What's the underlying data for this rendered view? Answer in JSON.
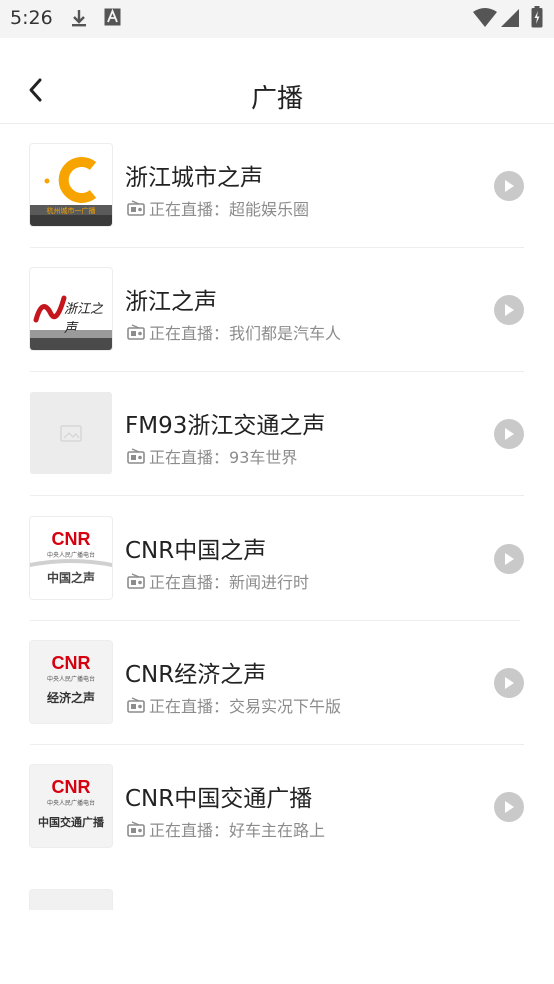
{
  "status_bar": {
    "time": "5:26",
    "left_icons": [
      "download-icon",
      "text-a-icon"
    ],
    "right_icons": [
      "wifi-icon",
      "cellular-icon",
      "battery-icon"
    ]
  },
  "app_bar": {
    "title": "广播",
    "back_icon": "chevron-left-icon"
  },
  "stations": [
    {
      "name": "浙江城市之声",
      "live_prefix": "正在直播：",
      "program": "超能娱乐圈",
      "logo": "orange-c-logo",
      "logo_caption": "杭州城市一广播"
    },
    {
      "name": "浙江之声",
      "live_prefix": "正在直播：",
      "program": "我们都是汽车人",
      "logo": "zhejiang-zhisheng-logo",
      "logo_caption": "浙江之声"
    },
    {
      "name": "FM93浙江交通之声",
      "live_prefix": "正在直播：",
      "program": "93车世界",
      "logo": "image-placeholder-icon"
    },
    {
      "name": "CNR中国之声",
      "live_prefix": "正在直播：",
      "program": "新闻进行时",
      "logo": "cnr-logo",
      "logo_brand": "CNR",
      "logo_sub": "中央人民广播电台",
      "logo_caption": "中国之声"
    },
    {
      "name": "CNR经济之声",
      "live_prefix": "正在直播：",
      "program": "交易实况下午版",
      "logo": "cnr-logo",
      "logo_brand": "CNR",
      "logo_sub": "中央人民广播电台",
      "logo_caption": "经济之声"
    },
    {
      "name": "CNR中国交通广播",
      "live_prefix": "正在直播：",
      "program": "好车主在路上",
      "logo": "cnr-logo",
      "logo_brand": "CNR",
      "logo_sub": "中央人民广播电台",
      "logo_caption": "中国交通广播"
    }
  ],
  "colors": {
    "play_button": "#c9c9c9",
    "cnr_red": "#d7000f",
    "orange": "#f7a400",
    "secondary_text": "#8c8c8c"
  }
}
